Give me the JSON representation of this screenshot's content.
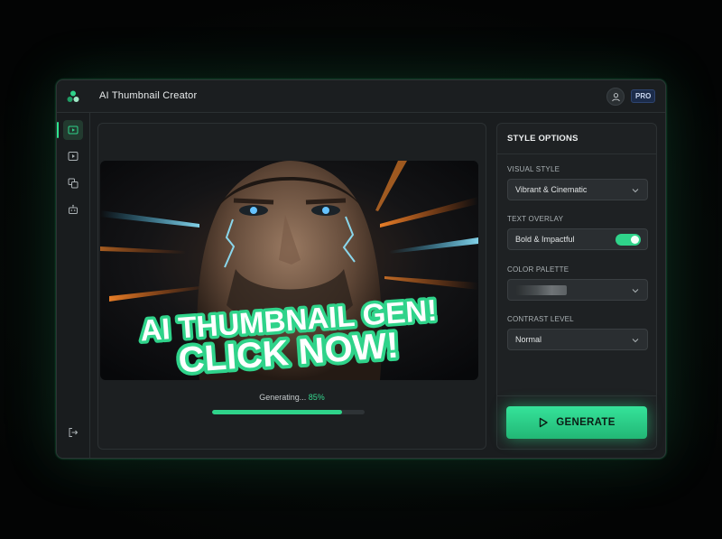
{
  "app": {
    "title": "AI Thumbnail Creator",
    "badge": "PRO"
  },
  "sidebar": {
    "items": [
      {
        "icon": "video-play-icon",
        "active": true
      },
      {
        "icon": "play-icon",
        "active": false
      },
      {
        "icon": "copy-icon",
        "active": false
      },
      {
        "icon": "robot-icon",
        "active": false
      }
    ],
    "footer_icon": "logout-icon"
  },
  "preview": {
    "headline_line1": "AI THUMBNAIL GEN!",
    "headline_line2": "CLICK NOW!",
    "progress": {
      "label": "Generating...",
      "percent_text": "85%",
      "value": 0.85
    }
  },
  "options": {
    "header": "STYLE OPTIONS",
    "visual_style": {
      "label": "VISUAL STYLE",
      "value": "Vibrant & Cinematic"
    },
    "text_overlay": {
      "label": "TEXT OVERLAY",
      "value": "Bold & Impactful",
      "enabled": true
    },
    "color_palette": {
      "label": "COLOR PALETTE"
    },
    "contrast_level": {
      "label": "CONTRAST LEVEL",
      "value": "Normal"
    },
    "generate_label": "GENERATE"
  },
  "colors": {
    "accent": "#2fd38a",
    "background": "#1a1d1f",
    "badge": "#1c2c4a"
  }
}
